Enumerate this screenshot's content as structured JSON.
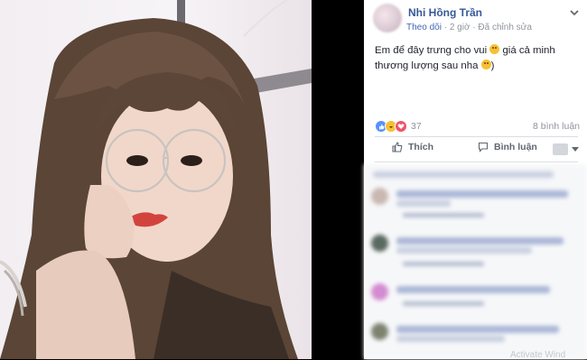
{
  "post": {
    "author_name": "Nhi Hồng Trần",
    "follow_label": "Theo dõi",
    "separator": "·",
    "time": "2 giờ",
    "edited_label": "Đã chỉnh sửa",
    "text_before_emoji1": "Em để đây trưng cho vui",
    "text_between": " giá cả minh thương lượng sau nha",
    "text_end": ")"
  },
  "reactions": {
    "icons": [
      "like-icon",
      "haha-icon",
      "love-icon"
    ],
    "count": "37",
    "comment_count": "8 bình luận"
  },
  "actions": {
    "like_label": "Thích",
    "comment_label": "Bình luận"
  },
  "watermark": "Activate Wind",
  "colors": {
    "link_blue": "#365899",
    "meta_gray": "#90949c",
    "action_gray": "#606770",
    "like_blue": "#5890ff",
    "love_red": "#f25268",
    "haha_yellow": "#f7c033"
  }
}
